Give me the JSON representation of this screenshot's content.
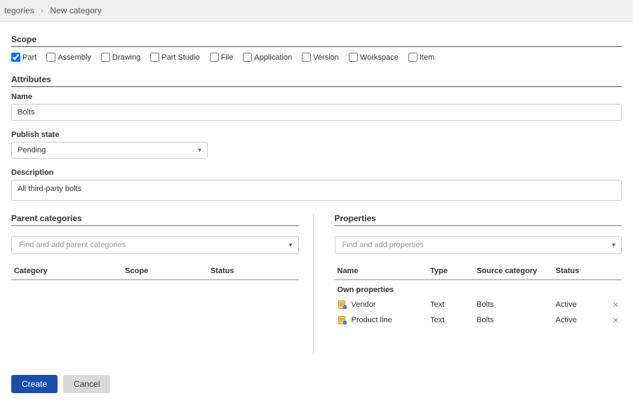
{
  "breadcrumb": {
    "prev_partial": "tegories",
    "current": "New category"
  },
  "scope": {
    "title": "Scope",
    "options": [
      {
        "label": "Part",
        "checked": true
      },
      {
        "label": "Assembly",
        "checked": false
      },
      {
        "label": "Drawing",
        "checked": false
      },
      {
        "label": "Part Studio",
        "checked": false
      },
      {
        "label": "File",
        "checked": false
      },
      {
        "label": "Application",
        "checked": false
      },
      {
        "label": "Version",
        "checked": false
      },
      {
        "label": "Workspace",
        "checked": false
      },
      {
        "label": "Item",
        "checked": false
      }
    ]
  },
  "attributes": {
    "title": "Attributes",
    "name_label": "Name",
    "name_value": "Bolts",
    "publish_label": "Publish state",
    "publish_value": "Pending",
    "description_label": "Description",
    "description_value": "All third-party bolts"
  },
  "parent_categories": {
    "title": "Parent categories",
    "search_placeholder": "Find and add parent categories",
    "columns": {
      "category": "Category",
      "scope": "Scope",
      "status": "Status"
    },
    "rows": []
  },
  "properties": {
    "title": "Properties",
    "search_placeholder": "Find and add properties",
    "columns": {
      "name": "Name",
      "type": "Type",
      "source": "Source category",
      "status": "Status"
    },
    "group_label": "Own properties",
    "rows": [
      {
        "name": "Vendor",
        "type": "Text",
        "source": "Bolts",
        "status": "Active"
      },
      {
        "name": "Product line",
        "type": "Text",
        "source": "Bolts",
        "status": "Active"
      }
    ]
  },
  "buttons": {
    "create": "Create",
    "cancel": "Cancel"
  }
}
